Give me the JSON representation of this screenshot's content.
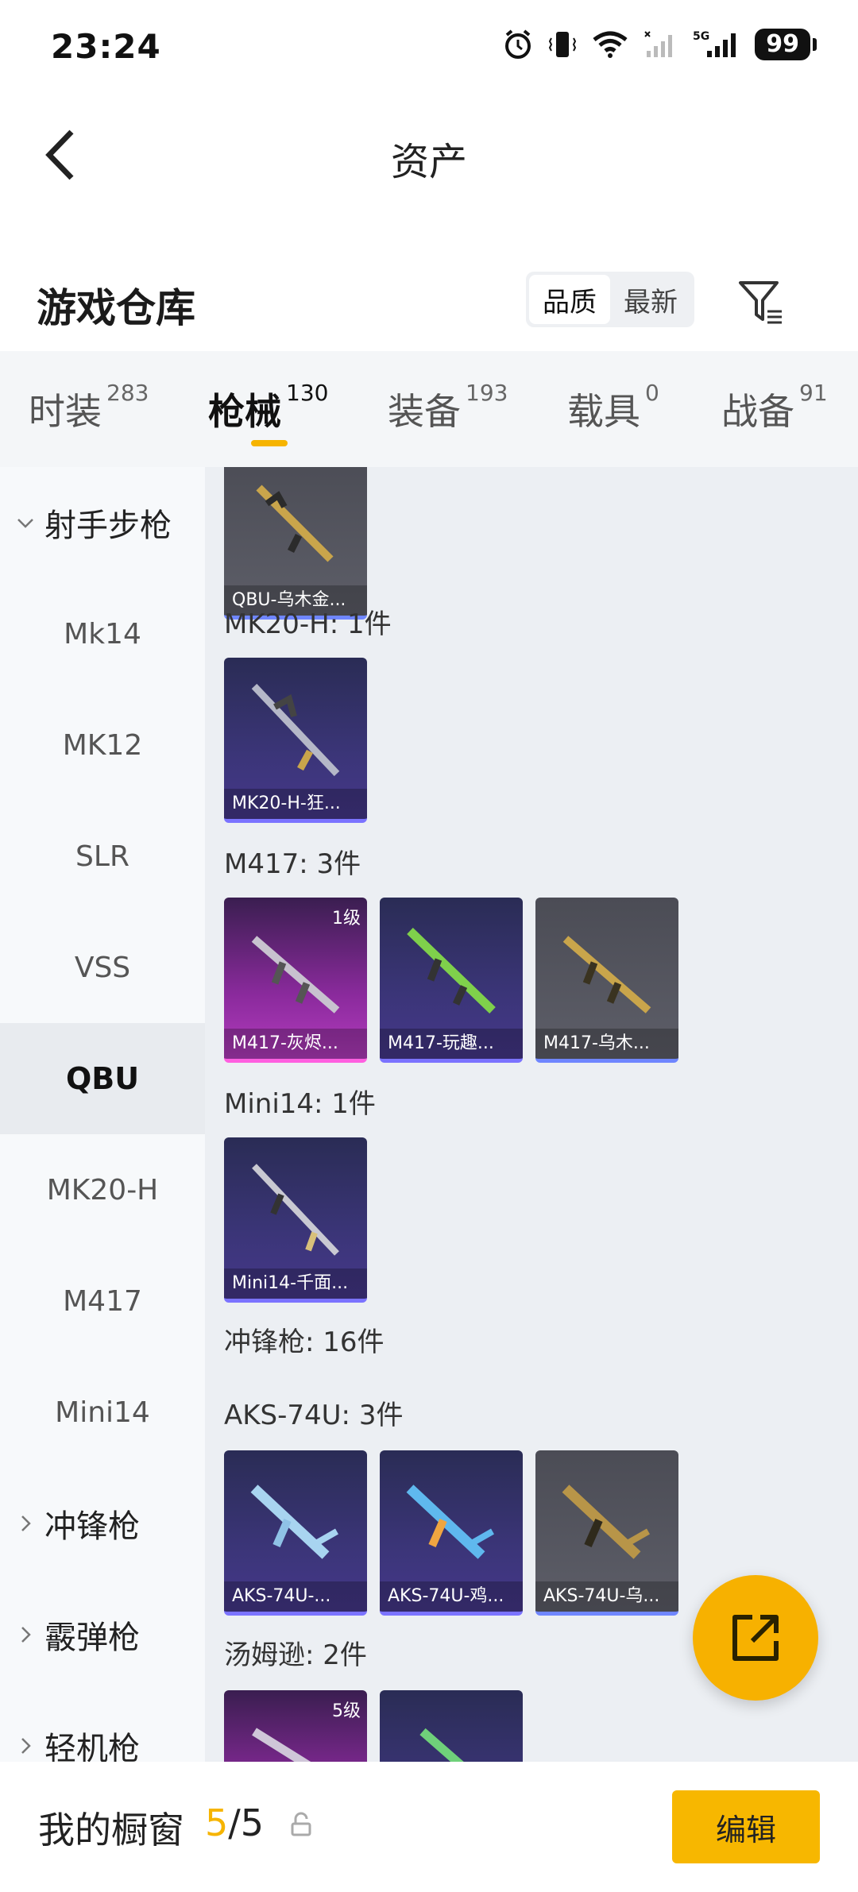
{
  "status": {
    "time": "23:24",
    "network": "5G",
    "battery": "99"
  },
  "nav": {
    "title": "资产"
  },
  "header": {
    "title": "游戏仓库",
    "sort_options": [
      "品质",
      "最新"
    ]
  },
  "tabs": [
    {
      "label": "时装",
      "count": "283"
    },
    {
      "label": "枪械",
      "count": "130"
    },
    {
      "label": "装备",
      "count": "193"
    },
    {
      "label": "载具",
      "count": "0"
    },
    {
      "label": "战备",
      "count": "91"
    }
  ],
  "sidebar": [
    {
      "label": "射手步枪",
      "type": "group",
      "expanded": true
    },
    {
      "label": "Mk14"
    },
    {
      "label": "MK12"
    },
    {
      "label": "SLR"
    },
    {
      "label": "VSS"
    },
    {
      "label": "QBU",
      "active": true
    },
    {
      "label": "MK20-H"
    },
    {
      "label": "M417"
    },
    {
      "label": "Mini14"
    },
    {
      "label": "冲锋枪",
      "type": "group"
    },
    {
      "label": "霰弹枪",
      "type": "group"
    },
    {
      "label": "轻机枪",
      "type": "group"
    }
  ],
  "content": {
    "sections": [
      {
        "label": "",
        "cards": [
          {
            "name": "QBU-乌木金...",
            "style": "gray",
            "badge": ""
          }
        ]
      },
      {
        "label": "MK20-H: 1件",
        "cards": [
          {
            "name": "MK20-H-狂...",
            "style": "purple",
            "badge": ""
          }
        ]
      },
      {
        "label": "M417: 3件",
        "cards": [
          {
            "name": "M417-灰烬...",
            "style": "pink",
            "badge": "1级"
          },
          {
            "name": "M417-玩趣...",
            "style": "purple",
            "badge": ""
          },
          {
            "name": "M417-乌木...",
            "style": "gray",
            "badge": ""
          }
        ]
      },
      {
        "label": "Mini14: 1件",
        "cards": [
          {
            "name": "Mini14-千面...",
            "style": "purple",
            "badge": ""
          }
        ]
      },
      {
        "label": "冲锋枪: 16件",
        "cards": []
      },
      {
        "label": "AKS-74U: 3件",
        "cards": [
          {
            "name": "AKS-74U-...",
            "style": "purple",
            "badge": ""
          },
          {
            "name": "AKS-74U-鸡...",
            "style": "purple",
            "badge": ""
          },
          {
            "name": "AKS-74U-乌...",
            "style": "gray",
            "badge": ""
          }
        ]
      },
      {
        "label": "汤姆逊: 2件",
        "cards": [
          {
            "name": "",
            "style": "pink",
            "badge": "5级"
          },
          {
            "name": "",
            "style": "purple",
            "badge": ""
          }
        ]
      }
    ]
  },
  "bottom": {
    "title": "我的橱窗",
    "count_current": "5",
    "count_total": "/5",
    "edit_label": "编辑"
  },
  "colors": {
    "accent": "#f6b400",
    "purple_card": "#3b3578",
    "gray_card": "#5d5e68",
    "pink_card": "#b23bbd"
  }
}
